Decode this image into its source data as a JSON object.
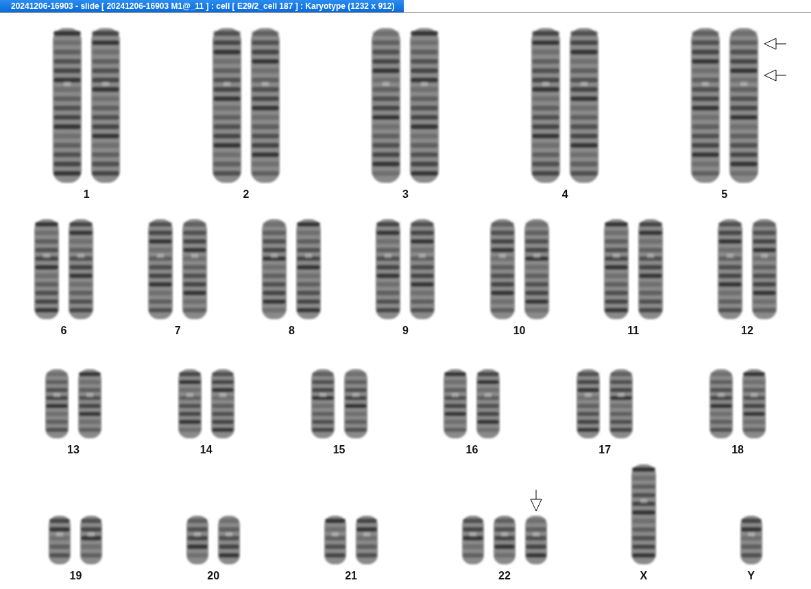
{
  "window": {
    "title": "20241206-16903 - slide [ 20241206-16903 M1@_11 ] : cell [ E29/2_cell 187 ] : Karyotype  (1232 x 912)"
  },
  "rows": [
    {
      "groups": [
        {
          "label": "1",
          "chromosomes": [
            {
              "kind": "long"
            },
            {
              "kind": "long"
            }
          ]
        },
        {
          "label": "2",
          "chromosomes": [
            {
              "kind": "long"
            },
            {
              "kind": "long"
            }
          ]
        },
        {
          "label": "3",
          "chromosomes": [
            {
              "kind": "long"
            },
            {
              "kind": "long"
            }
          ]
        },
        {
          "label": "4",
          "chromosomes": [
            {
              "kind": "long"
            },
            {
              "kind": "long"
            }
          ]
        },
        {
          "label": "5",
          "chromosomes": [
            {
              "kind": "long"
            },
            {
              "kind": "long",
              "arrows": [
                {
                  "kind": "left"
                },
                {
                  "kind": "left"
                }
              ]
            }
          ]
        }
      ]
    },
    {
      "groups": [
        {
          "label": "6",
          "chromosomes": [
            {
              "kind": "medium"
            },
            {
              "kind": "medium"
            }
          ]
        },
        {
          "label": "7",
          "chromosomes": [
            {
              "kind": "medium"
            },
            {
              "kind": "medium"
            }
          ]
        },
        {
          "label": "8",
          "chromosomes": [
            {
              "kind": "medium"
            },
            {
              "kind": "medium"
            }
          ]
        },
        {
          "label": "9",
          "chromosomes": [
            {
              "kind": "medium"
            },
            {
              "kind": "medium"
            }
          ]
        },
        {
          "label": "10",
          "chromosomes": [
            {
              "kind": "medium"
            },
            {
              "kind": "medium"
            }
          ]
        },
        {
          "label": "11",
          "chromosomes": [
            {
              "kind": "medium"
            },
            {
              "kind": "medium"
            }
          ]
        },
        {
          "label": "12",
          "chromosomes": [
            {
              "kind": "medium"
            },
            {
              "kind": "medium"
            }
          ]
        }
      ]
    },
    {
      "groups": [
        {
          "label": "13",
          "chromosomes": [
            {
              "kind": "short"
            },
            {
              "kind": "short"
            }
          ]
        },
        {
          "label": "14",
          "chromosomes": [
            {
              "kind": "short"
            },
            {
              "kind": "short"
            }
          ]
        },
        {
          "label": "15",
          "chromosomes": [
            {
              "kind": "short"
            },
            {
              "kind": "short"
            }
          ]
        },
        {
          "label": "16",
          "chromosomes": [
            {
              "kind": "short"
            },
            {
              "kind": "short"
            }
          ]
        },
        {
          "label": "17",
          "chromosomes": [
            {
              "kind": "short"
            },
            {
              "kind": "short"
            }
          ]
        },
        {
          "label": "18",
          "chromosomes": [
            {
              "kind": "short"
            },
            {
              "kind": "short"
            }
          ]
        }
      ]
    },
    {
      "groups": [
        {
          "label": "19",
          "chromosomes": [
            {
              "kind": "tiny"
            },
            {
              "kind": "tiny"
            }
          ]
        },
        {
          "label": "20",
          "chromosomes": [
            {
              "kind": "tiny"
            },
            {
              "kind": "tiny"
            }
          ]
        },
        {
          "label": "21",
          "chromosomes": [
            {
              "kind": "tiny"
            },
            {
              "kind": "tiny"
            }
          ]
        },
        {
          "label": "22",
          "chromosomes": [
            {
              "kind": "tiny"
            },
            {
              "kind": "tiny"
            },
            {
              "kind": "tiny",
              "arrows": [
                {
                  "kind": "down"
                }
              ]
            }
          ]
        },
        {
          "label": "X",
          "chromosomes": [
            {
              "kind": "medium"
            }
          ]
        },
        {
          "label": "Y",
          "chromosomes": [
            {
              "kind": "tiny"
            }
          ]
        }
      ]
    }
  ]
}
